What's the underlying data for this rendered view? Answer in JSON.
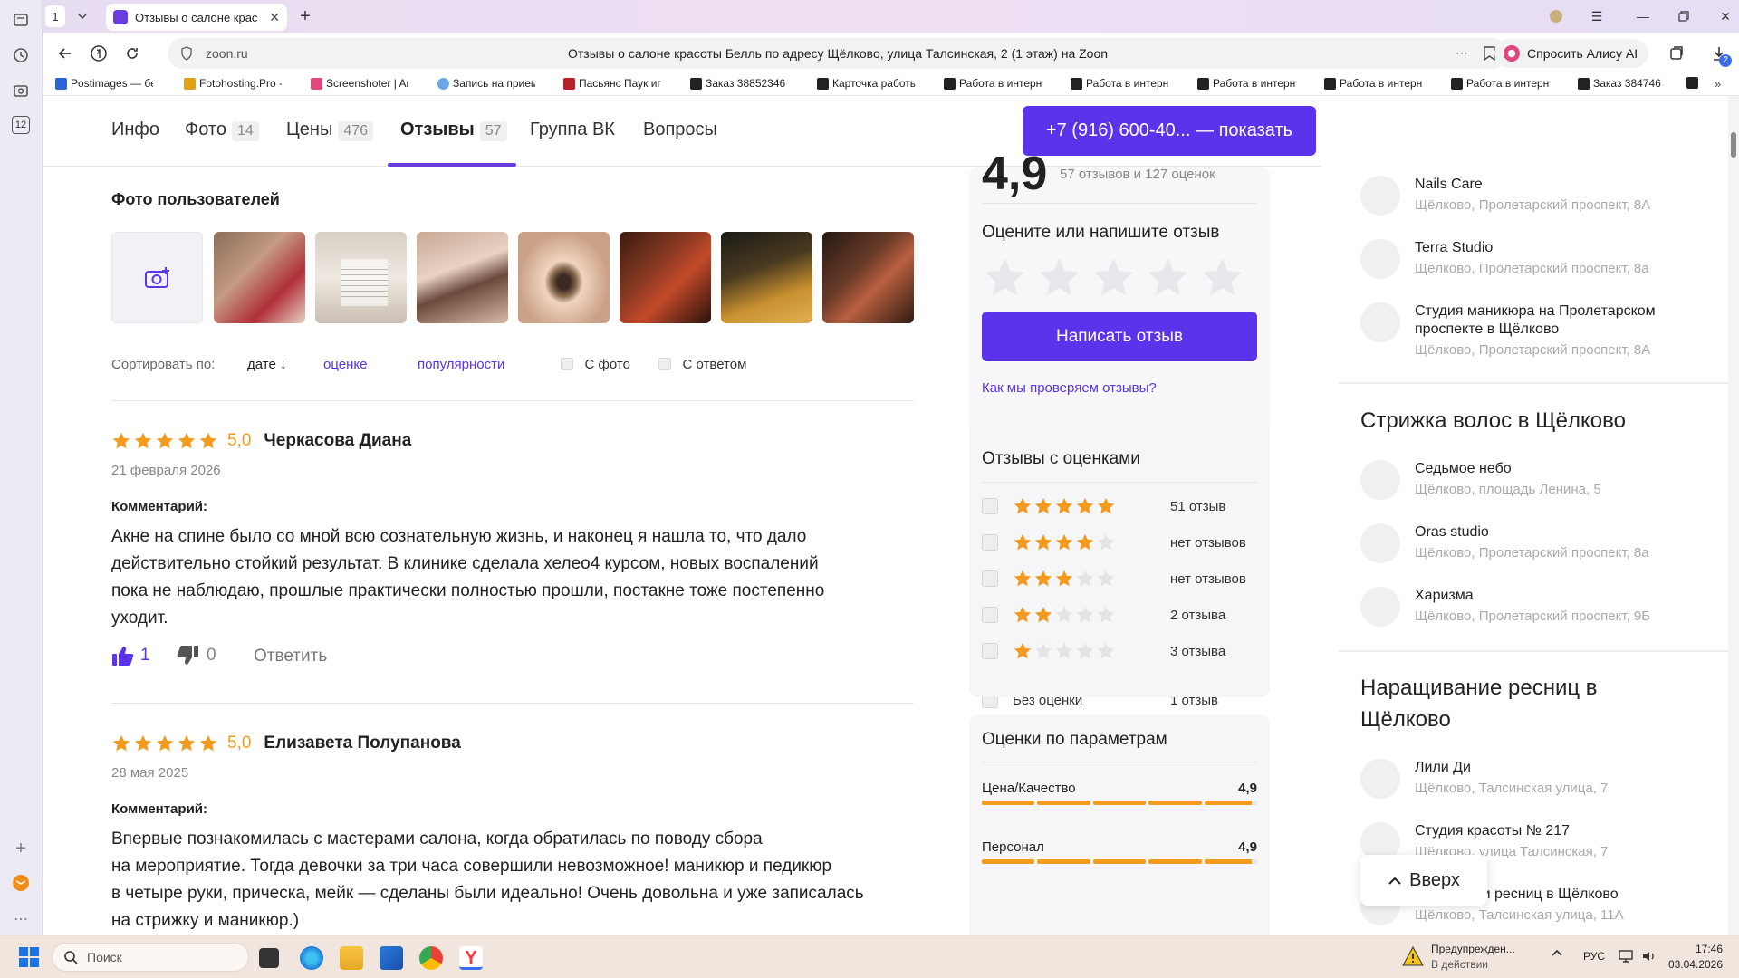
{
  "browser": {
    "tab_count": "1",
    "active_tab_title": "Отзывы о салоне крас",
    "url_domain": "zoon.ru",
    "page_title": "Отзывы о салоне красоты Белль по адресу Щёлково, улица Талсинская, 2 (1 этаж) на Zoon",
    "alice_button": "Спросить Алису AI",
    "downloads_badge": "2",
    "side_badge": "12",
    "bookmarks": [
      "Postimages — бес",
      "Fotohosting.Pro -",
      "Screenshoter | An",
      "Запись на прием",
      "Пасьянс Паук игр",
      "Заказ 38852346 /",
      "Карточка работы",
      "Работа в интерне",
      "Работа в интерне",
      "Работа в интерне",
      "Работа в интерне",
      "Работа в интерне",
      "Заказ 384746"
    ]
  },
  "nav": {
    "items": [
      {
        "label": "Инфо",
        "count": ""
      },
      {
        "label": "Фото",
        "count": "14"
      },
      {
        "label": "Цены",
        "count": "476"
      },
      {
        "label": "Отзывы",
        "count": "57"
      },
      {
        "label": "Группа ВК",
        "count": ""
      },
      {
        "label": "Вопросы",
        "count": ""
      }
    ],
    "phone_button": "+7 (916) 600-40... — показать"
  },
  "photos": {
    "title": "Фото пользователей"
  },
  "sort": {
    "label": "Сортировать по:",
    "by_date": "дате ↓",
    "by_rating": "оценке",
    "by_popularity": "популярности",
    "with_photo": "С фото",
    "with_reply": "С ответом"
  },
  "reviews": [
    {
      "rating_text": "5,0",
      "rating": 5,
      "author": "Черкасова Диана",
      "date": "21 февраля 2026",
      "comment_label": "Комментарий:",
      "lines": [
        "Акне на спине было со мной всю сознательную жизнь, и наконец я нашла то, что дало",
        "действительно стойкий результат. В клинике сделала хелео4 курсом, новых воспалений",
        "пока не наблюдаю, прошлые практически полностью прошли, постакне тоже постепенно",
        "уходит."
      ],
      "likes": "1",
      "dislikes": "0",
      "reply": "Ответить"
    },
    {
      "rating_text": "5,0",
      "rating": 5,
      "author": "Елизавета Полупанова",
      "date": "28 мая 2025",
      "comment_label": "Комментарий:",
      "lines": [
        "Впервые познакомилась с мастерами салона, когда обратилась по поводу сбора",
        "на мероприятие. Тогда девочки за три часа совершили невозможное! маникюр и педикюр",
        "в четыре руки, прическа, мейк — сделаны были идеально! Очень довольна и уже записалась",
        "на стрижку и маникюр.)"
      ]
    }
  ],
  "summary": {
    "big_rating": "4,9",
    "counts_text": "57 отзывов и 127 оценок",
    "rate_prompt": "Оцените или напишите отзыв",
    "write_button": "Написать отзыв",
    "verify_link": "Как мы проверяем отзывы?"
  },
  "ratings_breakdown": {
    "title": "Отзывы с оценками",
    "rows": [
      {
        "stars": 5,
        "count": "51 отзыв"
      },
      {
        "stars": 4,
        "count": "нет отзывов"
      },
      {
        "stars": 3,
        "count": "нет отзывов"
      },
      {
        "stars": 2,
        "count": "2 отзыва"
      },
      {
        "stars": 1,
        "count": "3 отзыва"
      }
    ],
    "no_rating_label": "Без оценки",
    "no_rating_count": "1 отзыв"
  },
  "params": {
    "title": "Оценки по параметрам",
    "rows": [
      {
        "label": "Цена/Качество",
        "value": "4,9",
        "fill": 0.98
      },
      {
        "label": "Персонал",
        "value": "4,9",
        "fill": 0.98
      }
    ]
  },
  "sidebar": {
    "group1": [
      {
        "name": "Nails Care",
        "addr": "Щёлково, Пролетарский проспект, 8А"
      },
      {
        "name": "Terra Studio",
        "addr": "Щёлково, Пролетарский проспект, 8а"
      },
      {
        "name_line1": "Студия маникюра на Пролетарском",
        "name_line2": "проспекте в Щёлково",
        "addr": "Щёлково, Пролетарский проспект, 8А"
      }
    ],
    "haircut_title": "Стрижка волос в Щёлково",
    "group2": [
      {
        "name": "Седьмое небо",
        "addr": "Щёлково, площадь Ленина, 5"
      },
      {
        "name": "Oras studio",
        "addr": "Щёлково, Пролетарский проспект, 8а"
      },
      {
        "name": "Харизма",
        "addr": "Щёлково, Пролетарский проспект, 9Б"
      }
    ],
    "lash_title_line1": "Наращивание ресниц в",
    "lash_title_line2": "Щёлково",
    "group3": [
      {
        "name": "Лили Ди",
        "addr": "Щёлково, Талсинская улица, 7"
      },
      {
        "name": "Студия красоты № 217",
        "addr": "Щёлково, улица Талсинская, 7"
      },
      {
        "name": "вей и ресниц в Щёлково",
        "addr": "Щёлково, Талсинская улица, 11А"
      }
    ],
    "up_button": "Вверх"
  },
  "taskbar": {
    "search_placeholder": "Поиск",
    "notification_title": "Предупрежден...",
    "notification_sub": "В действии",
    "language": "РУС",
    "time": "17:46",
    "date": "03.04.2026"
  },
  "colors": {
    "accent": "#5a33ea",
    "star": "#f39b1e",
    "star_empty": "#e3e3e3",
    "link": "#5a33ea"
  }
}
